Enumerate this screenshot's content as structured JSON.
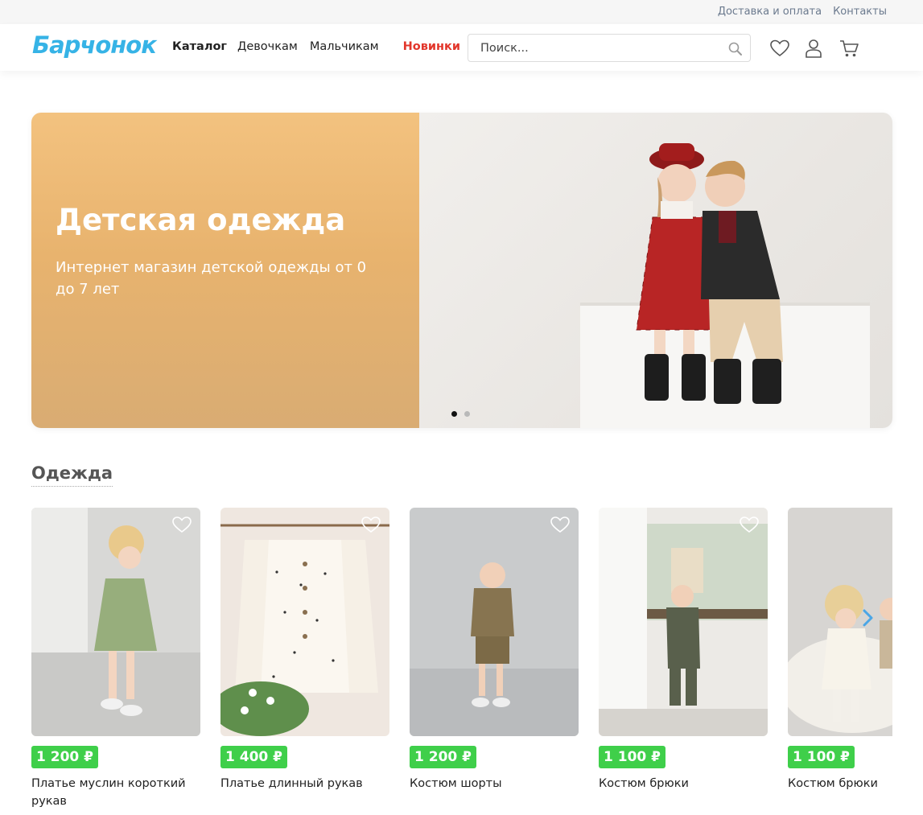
{
  "topbar": {
    "links": [
      "Доставка и оплата",
      "Контакты"
    ]
  },
  "header": {
    "logo": "Барчонок",
    "nav": {
      "catalog": "Каталог",
      "girls": "Девочкам",
      "boys": "Мальчикам",
      "new": "Новинки"
    },
    "search_placeholder": "Поиск...",
    "icons": [
      "search-icon",
      "heart-icon",
      "user-icon",
      "cart-icon"
    ]
  },
  "hero": {
    "title": "Детская одежда",
    "subtitle": "Интернет магазин детской одежды от 0 до 7 лет",
    "slides": 2,
    "active_slide": 1
  },
  "section": {
    "title": "Одежда"
  },
  "products": [
    {
      "price": "1 200 ₽",
      "name": "Платье муслин короткий рукав"
    },
    {
      "price": "1 400 ₽",
      "name": "Платье длинный рукав"
    },
    {
      "price": "1 200 ₽",
      "name": "Костюм шорты"
    },
    {
      "price": "1 100 ₽",
      "name": "Костюм брюки"
    },
    {
      "price": "1 100 ₽",
      "name": "Костюм брюки"
    }
  ],
  "colors": {
    "logo": "#36b3e6",
    "new_link": "#e2362b",
    "price_badge": "#3fcf4a",
    "hero_left": "#e8b36e"
  }
}
